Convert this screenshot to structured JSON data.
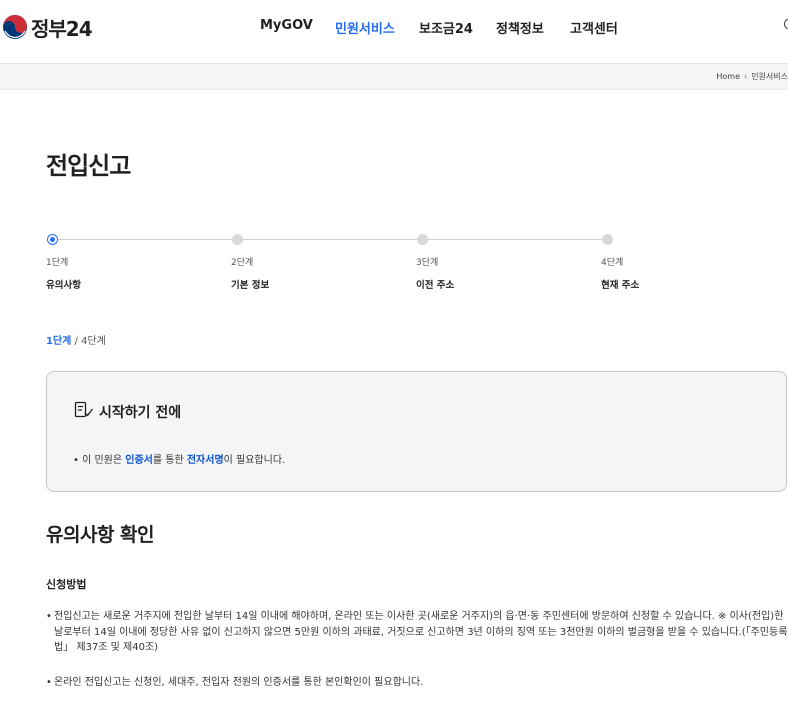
{
  "header": {
    "logo_text": "정부24",
    "nav": [
      {
        "label": "MyGOV"
      },
      {
        "label": "민원서비스"
      },
      {
        "label": "보조금24"
      },
      {
        "label": "정책정보"
      },
      {
        "label": "고객센터"
      }
    ],
    "active_nav": "민원서비스"
  },
  "breadcrumb": {
    "home": "Home",
    "current": "민원서비스"
  },
  "page_title": "전입신고",
  "steps": [
    {
      "num": "1단계",
      "name": "유의사항"
    },
    {
      "num": "2단계",
      "name": "기본 정보"
    },
    {
      "num": "3단계",
      "name": "이전 주소"
    },
    {
      "num": "4단계",
      "name": "현재 주소"
    }
  ],
  "step_counter": {
    "current": "1단계",
    "total": "/ 4단계"
  },
  "notice": {
    "title": "시작하기 전에",
    "text_before": "이 민원은 ",
    "highlight1": "인증서",
    "text_mid": "를 통한 ",
    "highlight2": "전자서명",
    "text_after": "이 필요합니다."
  },
  "section": {
    "title": "유의사항 확인",
    "subtitle": "신청방법",
    "bullets": [
      "전입신고는 새로운 거주지에 전입한 날부터 14일 이내에 해야하며, 온라인 또는 이사한 곳(새로운 거주지)의 읍·면·동 주민센터에 방문하여 신청할 수 있습니다. ※ 이사(전입)한 날로부터 14일 이내에 정당한 사유 없이 신고하지 않으면 5만원 이하의 과태료, 거짓으로 신고하면 3년 이하의 징역 또는 3천만원 이하의 벌금형을 받을 수 있습니다.(「주민등록법」 제37조 및 제40조)",
      "온라인 전입신고는 신청인, 세대주, 전입자 전원의 인증서를 통한 본인확인이 필요합니다."
    ]
  },
  "colors": {
    "accent": "#256ef4",
    "highlight": "#0b50d0",
    "notice_bg": "#f4f5f6"
  }
}
